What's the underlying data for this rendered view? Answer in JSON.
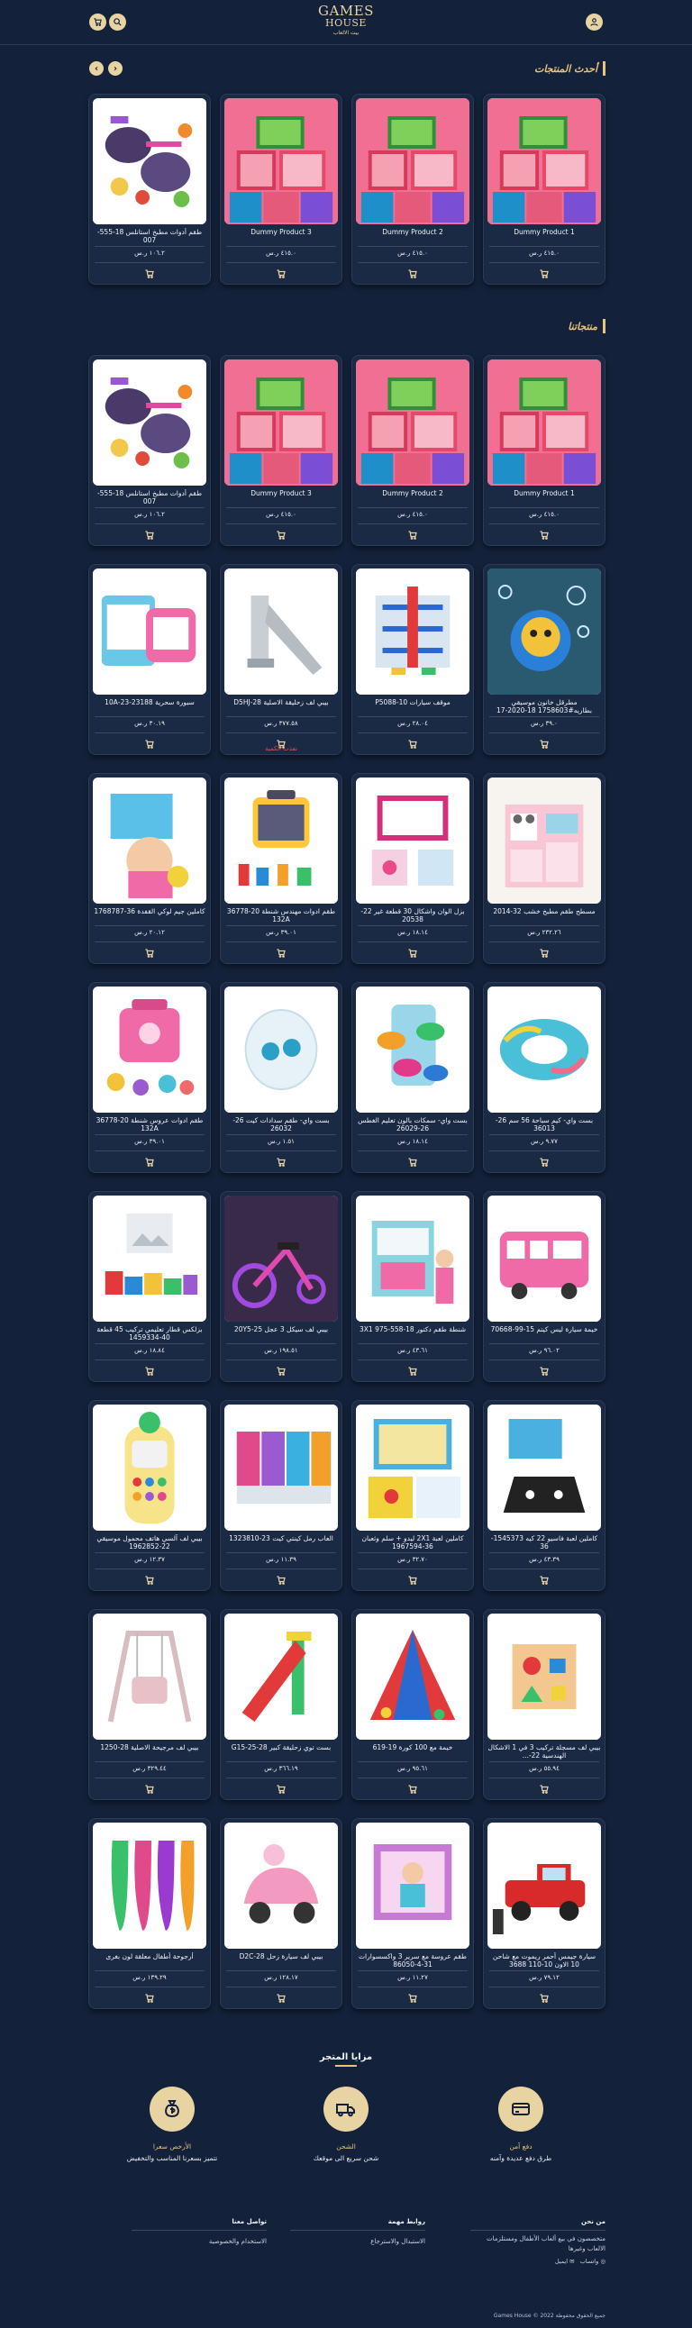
{
  "header": {
    "logo_main_1": "GAMES",
    "logo_main_2": "HOUSE",
    "logo_tag": "بيت الالعاب",
    "cart_icon": "cart-icon",
    "search_icon": "search-icon",
    "user_icon": "user-icon"
  },
  "latest": {
    "title": "أحدث المنتجات",
    "products": [
      {
        "name": "Dummy Product 1",
        "price": "٤١٥.٠ ر.س",
        "img": "boxes"
      },
      {
        "name": "Dummy Product 2",
        "price": "٤١٥.٠ ر.س",
        "img": "boxes"
      },
      {
        "name": "Dummy Product 3",
        "price": "٤١٥.٠ ر.س",
        "img": "boxes"
      },
      {
        "name": "طقم أدوات مطبخ استانلس 18-555-007",
        "price": "١٠٦.٢ ر.س",
        "img": "pans"
      }
    ]
  },
  "products": {
    "title": "منتجاتنا",
    "items": [
      {
        "name": "Dummy Product 1",
        "price": "٤١٥.٠ ر.س",
        "img": "boxes"
      },
      {
        "name": "Dummy Product 2",
        "price": "٤١٥.٠ ر.س",
        "img": "boxes"
      },
      {
        "name": "Dummy Product 3",
        "price": "٤١٥.٠ ر.س",
        "img": "boxes"
      },
      {
        "name": "طقم أدوات مطبخ استانلس 18-555-007",
        "price": "١٠٦.٢ ر.س",
        "img": "pans"
      },
      {
        "name": "مطرقل خانون موسيقي بطاريه#1758603 18-2020-17",
        "price": "٣٩.٠ ر.س",
        "img": "bubble"
      },
      {
        "name": "موقف سيارات P5088-10",
        "price": "٢٨.٠٤ ر.س",
        "img": "garage"
      },
      {
        "name": "بيبي لف زحليقة الاصلية 28-D5HJ",
        "price": "٣٧٧.٥٨ ر.س",
        "img": "slide",
        "out": "نفذت الكمية"
      },
      {
        "name": "سبورة سحرية 23188-23-10A",
        "price": "٣٠.١٩ ر.س",
        "img": "board"
      },
      {
        "name": "مسطح طقم مطبخ خشب 32-2014",
        "price": "٢٣٢.٢٦ ر.س",
        "img": "kitchen"
      },
      {
        "name": "بزل الوان واشكال 30 قطعة غير 22-20538",
        "price": "١٨.١٤ ر.س",
        "img": "puzzle"
      },
      {
        "name": "طقم ادوات مهندس شنطة 20-36778 132A",
        "price": "٣٩.٠١ ر.س",
        "img": "toolcase"
      },
      {
        "name": "كاملين جيم لوكي القفدة 36-1768787",
        "price": "٢٠.١٢ ر.س",
        "img": "baby"
      },
      {
        "name": "بست واي- كيم سباحة 56 سم 26-36013",
        "price": "٩.٧٧ ر.س",
        "img": "ring"
      },
      {
        "name": "بست واي- سمكات بالون تعليم الغطس 26-26029",
        "price": "١٨.١٤ ر.س",
        "img": "fish"
      },
      {
        "name": "بست واي- طقم سدادات كيت 26-26032",
        "price": "١.٥١ ر.س",
        "img": "goggles"
      },
      {
        "name": "طقم ادوات عروس شنطة 20-36778 132A",
        "price": "٣٩.٠١ ر.س",
        "img": "pinkbag"
      },
      {
        "name": "خيمة سيارة ليس كيتم 15-99-70668",
        "price": "٩٦.٠٢ ر.س",
        "img": "bus"
      },
      {
        "name": "شنطة طقم دكتور 18-558-975 3X1",
        "price": "٤٣.٦١ ر.س",
        "img": "doctor"
      },
      {
        "name": "بيبي لف سيكل 3 عجل 25-20Y5",
        "price": "١٩٨.٥١ ر.س",
        "img": "trike"
      },
      {
        "name": "بزلكس قطار تعليمي تركيب 45 قطعة 40-1459334",
        "price": "١٨.٨٤ ر.س",
        "img": "train"
      },
      {
        "name": "كاملين لعبة فاسيو 22 كيه 1545373-36",
        "price": "٤٣.٣٩ ر.س",
        "img": "game"
      },
      {
        "name": "كاملين لعبة 2X1 ليدو + سلم وثعبان 36-1967594",
        "price": "٣٢.٧٠ ر.س",
        "img": "ludo"
      },
      {
        "name": "العاب رمل كينتي كيت 23-1323810",
        "price": "١١.٣٩ ر.س",
        "img": "sand"
      },
      {
        "name": "بيبي لف آلسي هاتف محمول موسيقي 22-1962852",
        "price": "١٢.٣٧ ر.س",
        "img": "phone"
      },
      {
        "name": "بيبي لف مسجلة تركيب 3 في 1 الاشكال الهندسية 22-...",
        "price": "٥٥.٩٤ ر.س",
        "img": "cube"
      },
      {
        "name": "خيمة مع 100 كورة 19-619",
        "price": "٩٥.٦١ ر.س",
        "img": "tent"
      },
      {
        "name": "بست توي زحليقة كبير 28-G15-25",
        "price": "٣٦٦.١٩ ر.س",
        "img": "redslide"
      },
      {
        "name": "بيبي لف مرجيحة الاصلية 28-1250",
        "price": "٣٢٩.٤٤ ر.س",
        "img": "swing"
      },
      {
        "name": "سيارة جيمس أحمر ريموت مع شاحن 10 الاون 10-110 3688",
        "price": "٧٩.١٢ ر.س",
        "img": "truck"
      },
      {
        "name": "طقم عروسة مع سرير 3 واكسسوارات 31-4-86050",
        "price": "١١.٢٧ ر.س",
        "img": "doll"
      },
      {
        "name": "بيبي لف سيارة زحل 28-D2C",
        "price": "١٢٨.١٧ ر.س",
        "img": "rideon"
      },
      {
        "name": "أرجوحة أطفال معلقة لون بغرى",
        "price": "١٣٩.٢٩ ر.س",
        "img": "hammock"
      }
    ]
  },
  "features": {
    "title": "مزايا المتجر",
    "items": [
      {
        "title": "دفع آمن",
        "desc": "طرق دفع عديدة وآمنه",
        "icon": "card-icon"
      },
      {
        "title": "الشحن",
        "desc": "شحن سريع الى موقعك",
        "icon": "truck-icon"
      },
      {
        "title": "الأرخص سعرا",
        "desc": "تتميز بسعرنا المناسب والتخفيض",
        "icon": "money-bag-icon"
      }
    ]
  },
  "footer": {
    "about_head": "من نحن",
    "about_text": "متخصصون في بيع ألعاب الأطفال ومستلزمات الالعاب وغيرها",
    "whatsapp": "واتساب",
    "mail": "ايميل",
    "links_head": "روابط مهمة",
    "link1": "الاستبدال والاسترجاع",
    "contact_head": "تواصل معنا",
    "link2": "الاستخدام والخصوصية",
    "copyright": "جميع الحقوق محفوظة 2022 © Games House"
  },
  "colors": {
    "background": "#13213a",
    "accent": "#e8d3a2",
    "title": "#e8c57a"
  }
}
